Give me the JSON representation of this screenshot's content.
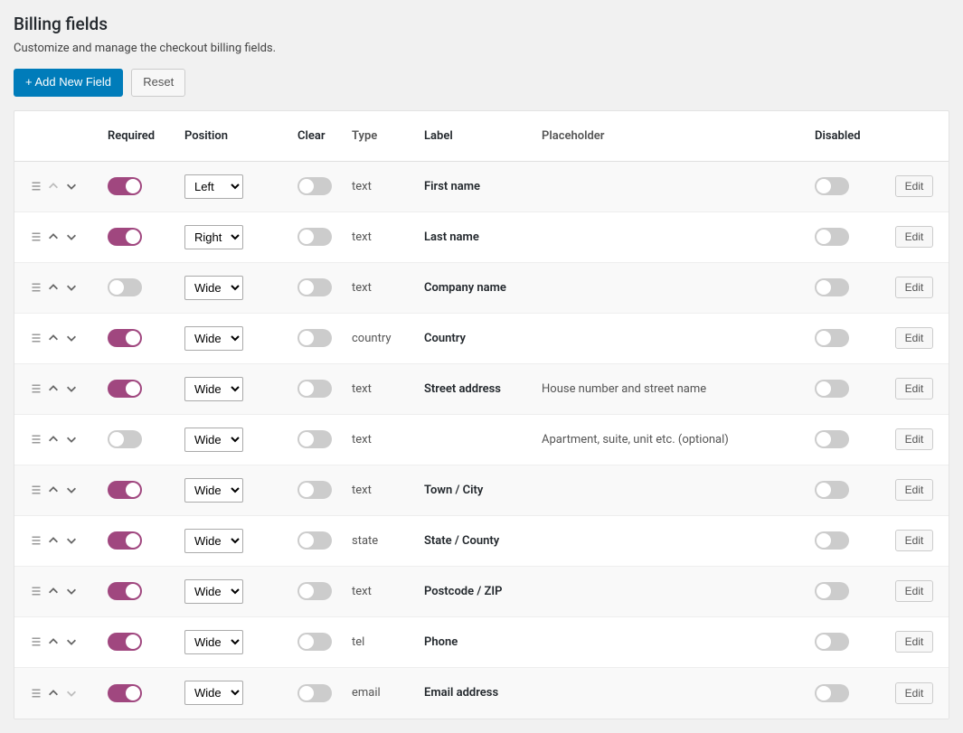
{
  "header": {
    "title": "Billing fields",
    "subtitle": "Customize and manage the checkout billing fields."
  },
  "toolbar": {
    "add_label": "+ Add New Field",
    "reset_label": "Reset"
  },
  "columns": {
    "required": "Required",
    "position": "Position",
    "clear": "Clear",
    "type": "Type",
    "label": "Label",
    "placeholder": "Placeholder",
    "disabled": "Disabled"
  },
  "position_options": [
    "Left",
    "Right",
    "Wide"
  ],
  "edit_label": "Edit",
  "rows": [
    {
      "required": true,
      "position": "Left",
      "clear": false,
      "type": "text",
      "label": "First name",
      "placeholder": "",
      "disabled": false,
      "up_disabled": true,
      "down_disabled": false
    },
    {
      "required": true,
      "position": "Right",
      "clear": false,
      "type": "text",
      "label": "Last name",
      "placeholder": "",
      "disabled": false,
      "up_disabled": false,
      "down_disabled": false
    },
    {
      "required": false,
      "position": "Wide",
      "clear": false,
      "type": "text",
      "label": "Company name",
      "placeholder": "",
      "disabled": false,
      "up_disabled": false,
      "down_disabled": false
    },
    {
      "required": true,
      "position": "Wide",
      "clear": false,
      "type": "country",
      "label": "Country",
      "placeholder": "",
      "disabled": false,
      "up_disabled": false,
      "down_disabled": false
    },
    {
      "required": true,
      "position": "Wide",
      "clear": false,
      "type": "text",
      "label": "Street address",
      "placeholder": "House number and street name",
      "disabled": false,
      "up_disabled": false,
      "down_disabled": false
    },
    {
      "required": false,
      "position": "Wide",
      "clear": false,
      "type": "text",
      "label": "",
      "placeholder": "Apartment, suite, unit etc. (optional)",
      "disabled": false,
      "up_disabled": false,
      "down_disabled": false
    },
    {
      "required": true,
      "position": "Wide",
      "clear": false,
      "type": "text",
      "label": "Town / City",
      "placeholder": "",
      "disabled": false,
      "up_disabled": false,
      "down_disabled": false
    },
    {
      "required": true,
      "position": "Wide",
      "clear": false,
      "type": "state",
      "label": "State / County",
      "placeholder": "",
      "disabled": false,
      "up_disabled": false,
      "down_disabled": false
    },
    {
      "required": true,
      "position": "Wide",
      "clear": false,
      "type": "text",
      "label": "Postcode / ZIP",
      "placeholder": "",
      "disabled": false,
      "up_disabled": false,
      "down_disabled": false
    },
    {
      "required": true,
      "position": "Wide",
      "clear": false,
      "type": "tel",
      "label": "Phone",
      "placeholder": "",
      "disabled": false,
      "up_disabled": false,
      "down_disabled": false
    },
    {
      "required": true,
      "position": "Wide",
      "clear": false,
      "type": "email",
      "label": "Email address",
      "placeholder": "",
      "disabled": false,
      "up_disabled": false,
      "down_disabled": true
    }
  ]
}
